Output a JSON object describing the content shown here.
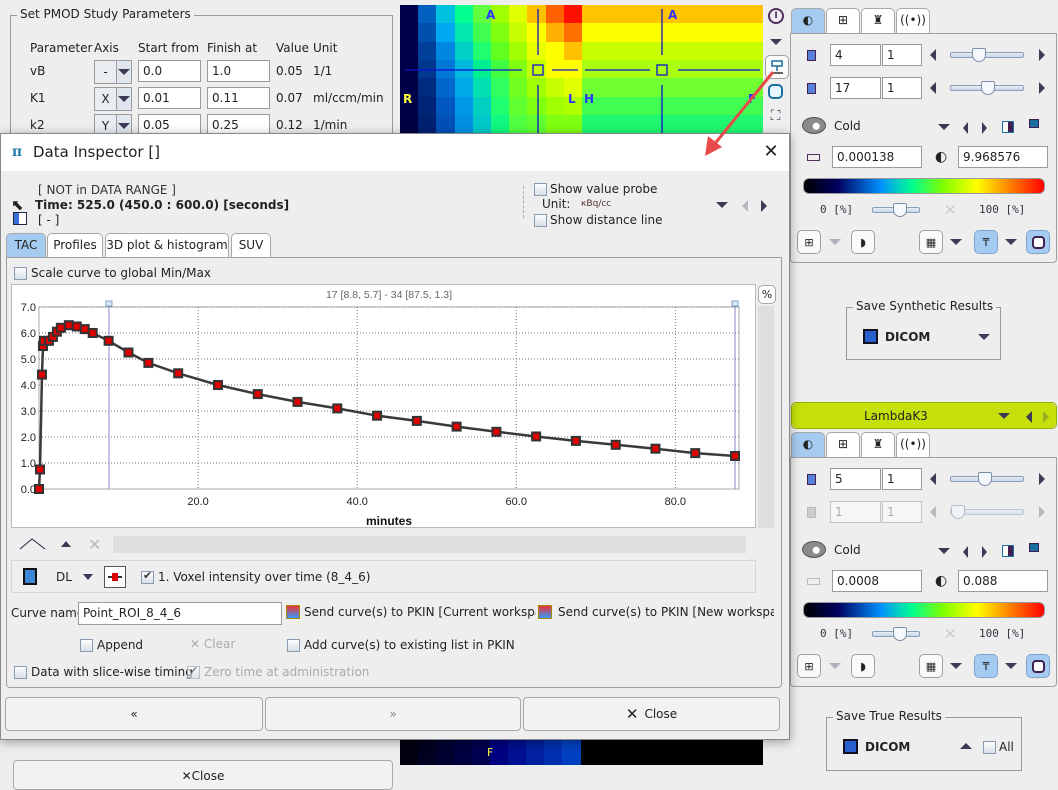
{
  "study_params": {
    "title": "Set PMOD Study Parameters",
    "headers": [
      "Parameter",
      "Axis",
      "Start from",
      "Finish at",
      "Value",
      "Unit"
    ],
    "rows": [
      {
        "param": "vB",
        "axis": "-",
        "start": "0.0",
        "finish": "1.0",
        "value": "0.05",
        "unit": "1/1"
      },
      {
        "param": "K1",
        "axis": "X",
        "start": "0.01",
        "finish": "0.11",
        "value": "0.07",
        "unit": "ml/ccm/min"
      },
      {
        "param": "k2",
        "axis": "Y",
        "start": "0.05",
        "finish": "0.25",
        "value": "0.12",
        "unit": "1/min"
      }
    ]
  },
  "image_view": {
    "orientation_labels": {
      "top_left": "A",
      "top_right": "A",
      "left": "R",
      "center_l": "L",
      "center_h": "H",
      "right": "F",
      "bottom": "F"
    }
  },
  "dialog": {
    "title": "Data Inspector []",
    "info": {
      "range": "[ NOT in DATA RANGE ]",
      "time": "Time: 525.0 (450.0 : 600.0) [seconds]",
      "value": "[ - ]"
    },
    "show_value_probe": "Show value probe",
    "unit_label": "Unit:",
    "unit_value": "кBq/cc",
    "show_distance_line": "Show distance line",
    "tabs": [
      {
        "label": "TAC",
        "selected": true
      },
      {
        "label": "Profiles"
      },
      {
        "label": "3D plot & histogram"
      },
      {
        "label": "SUV"
      }
    ],
    "scale_curve": "Scale curve to global Min/Max",
    "percent_button": "%",
    "curve_entry": {
      "format": "DL",
      "label": "1. Voxel intensity over time (8_4_6)",
      "checked": true
    },
    "curve_name_label": "Curve name",
    "curve_name_value": "Point_ROI_8_4_6",
    "send_current": "Send curve(s) to PKIN [Current workspace]",
    "send_new": "Send curve(s) to PKIN [New workspace]",
    "append": "Append",
    "clear": "Clear",
    "add_existing": "Add curve(s) to existing list in PKIN",
    "slice_wise": "Data with slice-wise timing",
    "zero_time": "Zero time at administration",
    "prev_button": "«",
    "next_button": "»",
    "close_button": "Close"
  },
  "chart_data": {
    "type": "line",
    "title": "17 [8.8, 5.7] - 34 [87.5, 1.3]",
    "xlabel": "minutes",
    "ylabel": "",
    "xlim": [
      0,
      88
    ],
    "ylim": [
      0,
      7
    ],
    "xticks": [
      "20.0",
      "40.0",
      "60.0",
      "80.0"
    ],
    "xtick_values": [
      20,
      40,
      60,
      80
    ],
    "yticks": [
      "0.0",
      "1.0",
      "2.0",
      "3.0",
      "4.0",
      "5.0",
      "6.0",
      "7.0"
    ],
    "ytick_values": [
      0,
      1,
      2,
      3,
      4,
      5,
      6,
      7
    ],
    "grid": true,
    "cursor_x": [
      8.8,
      87.5
    ],
    "marker_color": "#e00000",
    "line_color": "#3a3a3a",
    "x": [
      0,
      0.125,
      0.375,
      0.5,
      0.625,
      1.25,
      1.75,
      2.25,
      2.75,
      3.75,
      4.75,
      5.75,
      6.75,
      8.75,
      11.25,
      13.75,
      17.5,
      22.5,
      27.5,
      32.5,
      37.5,
      42.5,
      47.5,
      52.5,
      57.5,
      62.5,
      67.5,
      72.5,
      77.5,
      82.5,
      87.5
    ],
    "y": [
      0.0,
      0.75,
      4.4,
      5.5,
      5.7,
      5.7,
      5.85,
      6.05,
      6.2,
      6.3,
      6.25,
      6.15,
      6.0,
      5.7,
      5.25,
      4.85,
      4.45,
      4.0,
      3.65,
      3.35,
      3.1,
      2.82,
      2.62,
      2.4,
      2.2,
      2.02,
      1.85,
      1.7,
      1.55,
      1.38,
      1.27
    ]
  },
  "right_panel": {
    "tabs": [
      "contrast-icon",
      "layout-icon",
      "tools-icon",
      "fusion-icon"
    ],
    "top": {
      "slice": "4",
      "slice_step": "1",
      "frame": "17",
      "frame_step": "1",
      "colortable": "Cold",
      "min": "0.000138",
      "max": "9.968576",
      "pct_min": "0 [%]",
      "pct_max": "100 [%]",
      "slice_level": 0.35,
      "frame_level": 0.5
    },
    "save_synthetic": {
      "title": "Save Synthetic Results",
      "format": "DICOM"
    },
    "series_name": "LambdaK3",
    "series_color": "#c5e00a",
    "bottom": {
      "slice": "5",
      "slice_step": "1",
      "frame": "1",
      "frame_step": "1",
      "colortable": "Cold",
      "min": "0.0008",
      "max": "0.088",
      "pct_min": "0 [%]",
      "pct_max": "100 [%]",
      "slice_level": 0.45,
      "frame_level": 0.0
    },
    "save_true": {
      "title": "Save True Results",
      "format": "DICOM",
      "all": "All"
    }
  },
  "bottom_left_button": "Close"
}
